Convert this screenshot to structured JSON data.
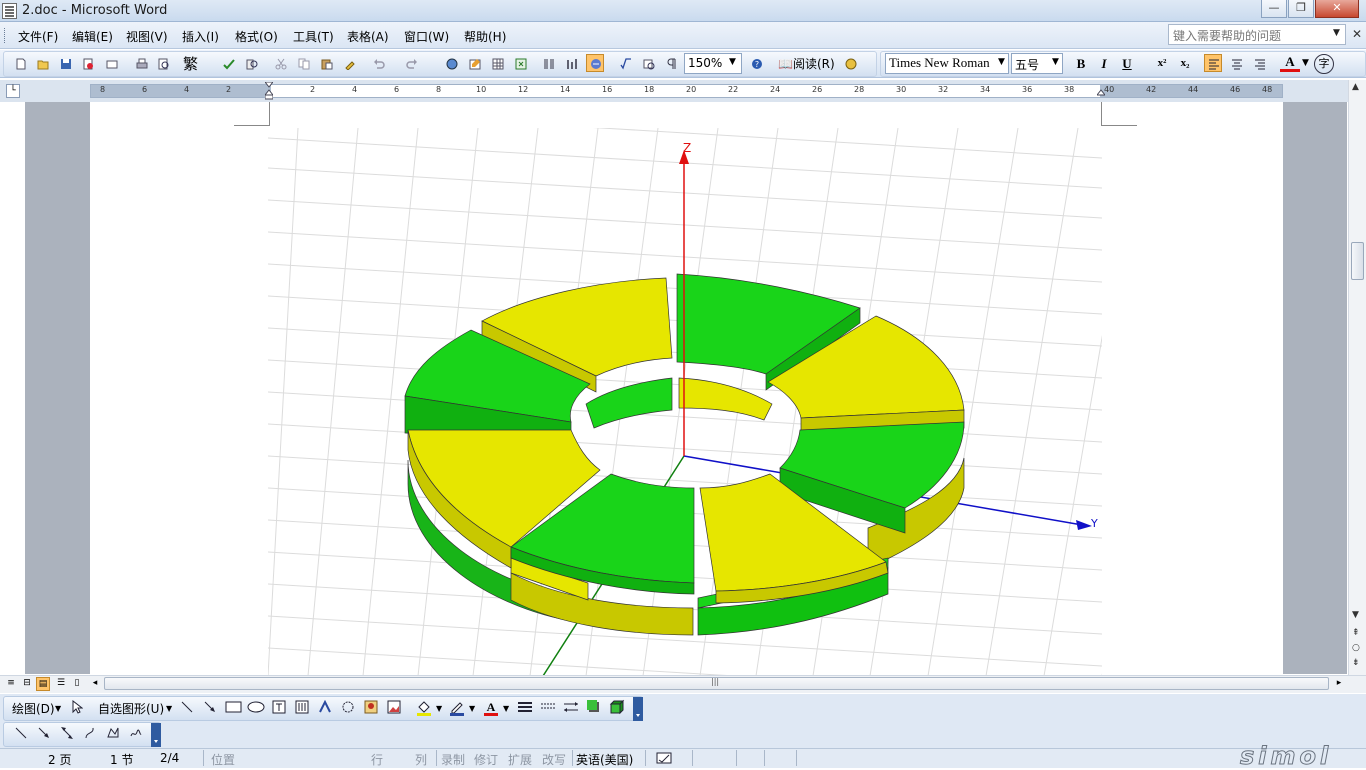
{
  "window": {
    "title": "2.doc - Microsoft Word",
    "min": "—",
    "max": "❐",
    "close": "✕"
  },
  "menu": [
    "文件(F)",
    "编辑(E)",
    "视图(V)",
    "插入(I)",
    "格式(O)",
    "工具(T)",
    "表格(A)",
    "窗口(W)",
    "帮助(H)"
  ],
  "help_placeholder": "键入需要帮助的问题",
  "toolbar": {
    "trad_char": "繁",
    "zoom": "150%",
    "read_label": "阅读(R)",
    "font_name": "Times New Roman",
    "font_size": "五号",
    "bold": "B",
    "italic": "I",
    "underline": "U",
    "superscript": "x²",
    "subscript": "x₂",
    "font_color_label": "A",
    "enclose_char": "字"
  },
  "ruler_ticks": [
    "8",
    "6",
    "4",
    "2",
    "2",
    "4",
    "6",
    "8",
    "10",
    "12",
    "14",
    "16",
    "18",
    "20",
    "22",
    "24",
    "26",
    "28",
    "30",
    "32",
    "34",
    "36",
    "38",
    "40",
    "42",
    "44",
    "46",
    "48"
  ],
  "drawing_toolbar": {
    "draw": "绘图(D)",
    "autoshapes": "自选图形(U)"
  },
  "figure": {
    "axis_z": "Z",
    "axis_y": "Y"
  },
  "status": {
    "page": "2 页",
    "section": "1 节",
    "pages": "2/4",
    "position": "位置",
    "line": "行",
    "col": "列",
    "rec": "录制",
    "trk": "修订",
    "ext": "扩展",
    "ovr": "改写",
    "lang": "英语(美国)"
  },
  "watermark": "simol",
  "colors": {
    "green": "#19d419",
    "yellow": "#e6e600",
    "axis_z": "#e01010",
    "axis_y": "#1010c8",
    "axis_x": "#108010"
  }
}
